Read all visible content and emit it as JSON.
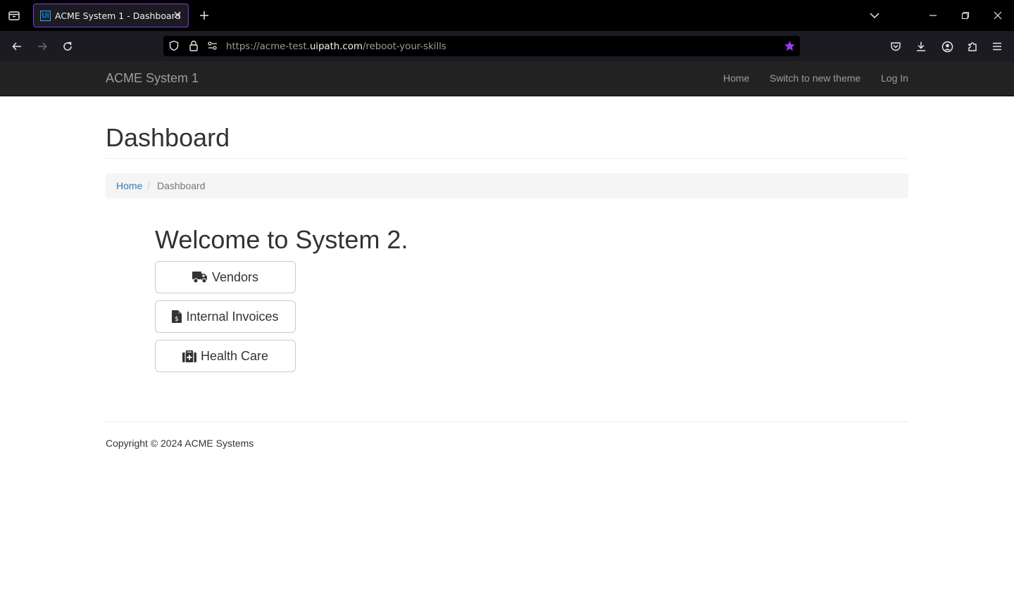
{
  "browser": {
    "tab_title": "ACME System 1 - Dashboard",
    "favicon_text": "Ui",
    "url_prefix": "https://acme-test.",
    "url_domain": "uipath.com",
    "url_path": "/reboot-your-skills",
    "accent_color": "#7b3ce0",
    "icons": [
      "tab-list-icon",
      "close-icon",
      "new-tab-icon",
      "tab-overflow-icon",
      "minimize-icon",
      "restore-icon",
      "window-close-icon",
      "back-icon",
      "forward-icon",
      "reload-icon",
      "shield-icon",
      "lock-icon",
      "permissions-icon",
      "bookmark-star-icon",
      "pocket-icon",
      "download-icon",
      "account-icon",
      "extensions-icon",
      "menu-icon"
    ]
  },
  "site_nav": {
    "brand": "ACME System 1",
    "links": [
      {
        "label": "Home"
      },
      {
        "label": "Switch to new theme"
      },
      {
        "label": "Log In"
      }
    ]
  },
  "page": {
    "title": "Dashboard",
    "breadcrumb": {
      "home": "Home",
      "separator": "/",
      "current": "Dashboard"
    },
    "welcome": "Welcome to System 2.",
    "buttons": [
      {
        "label": "Vendors",
        "icon": "truck-icon"
      },
      {
        "label": "Internal Invoices",
        "icon": "invoice-icon"
      },
      {
        "label": "Health Care",
        "icon": "medkit-icon"
      }
    ]
  },
  "footer": {
    "copyright": "Copyright © 2024 ACME Systems"
  },
  "colors": {
    "navbar_bg": "#222222",
    "link": "#337ab7",
    "text": "#333333"
  }
}
